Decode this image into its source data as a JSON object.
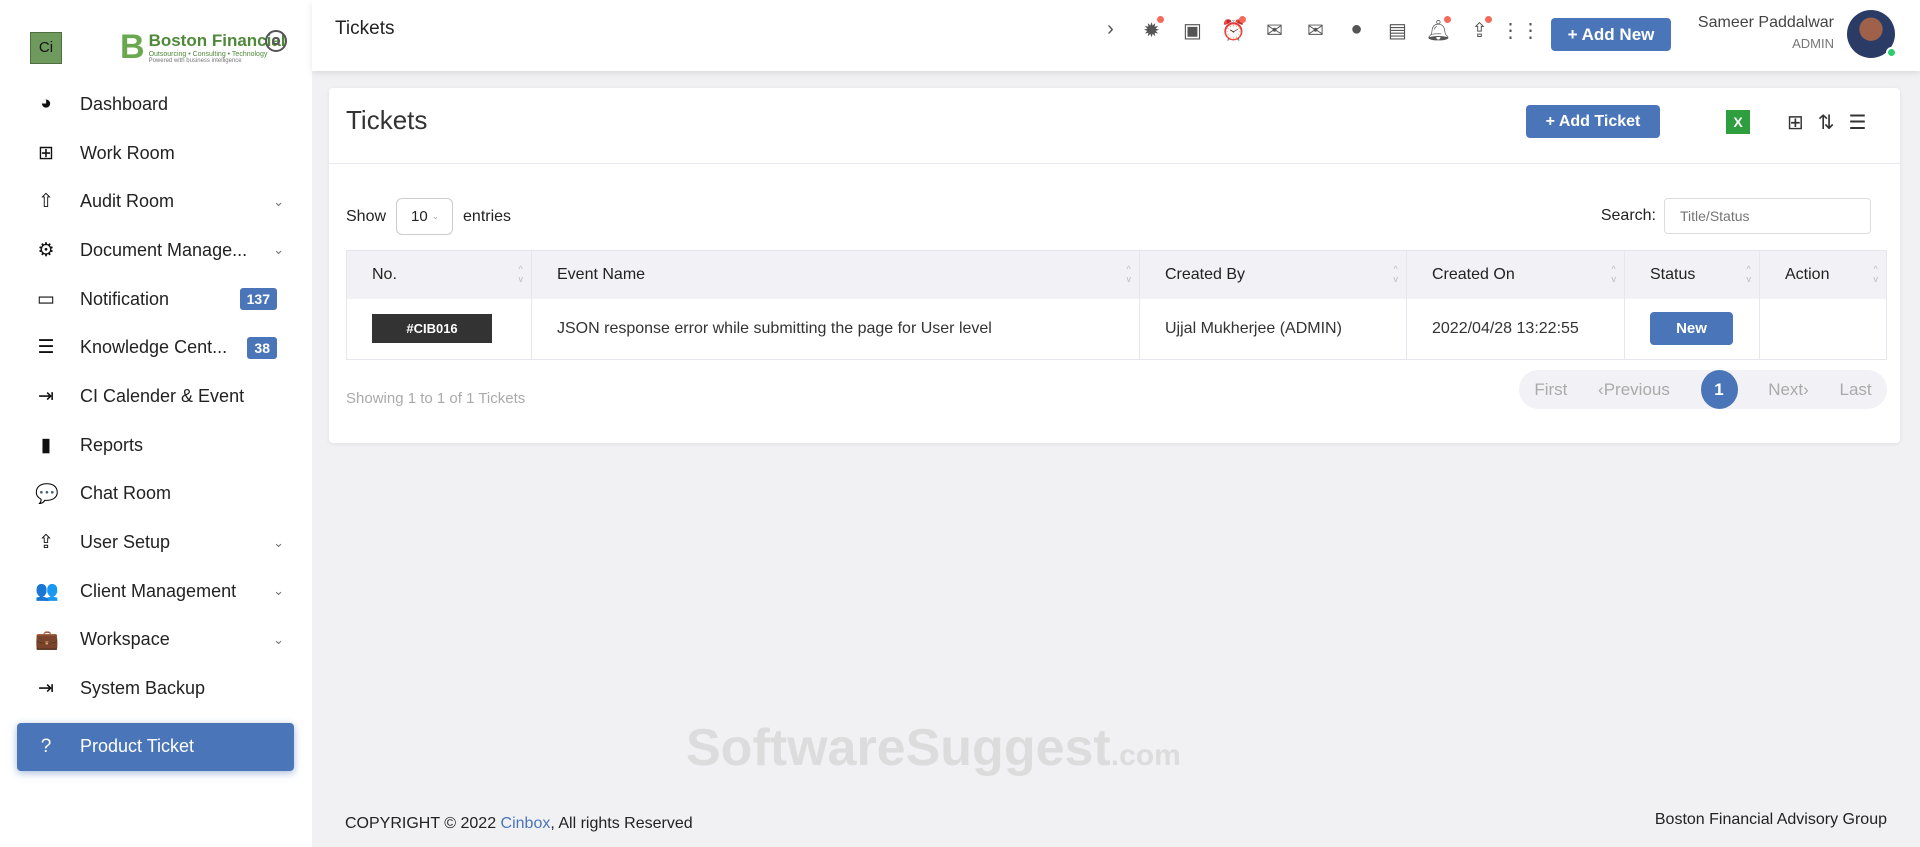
{
  "brand": {
    "ci": "Ci",
    "name": "Boston Financial",
    "tagline": "Outsourcing • Consulting • Technology",
    "sub": "Powered with business intelligence"
  },
  "sidebar": {
    "items": [
      {
        "label": "Dashboard",
        "icon": "◕"
      },
      {
        "label": "Work Room",
        "icon": "⊞"
      },
      {
        "label": "Audit Room",
        "icon": "⇧",
        "chevron": true
      },
      {
        "label": "Document Manage...",
        "icon": "⚙",
        "chevron": true
      },
      {
        "label": "Notification",
        "icon": "▭",
        "badge": "137"
      },
      {
        "label": "Knowledge Cent...",
        "icon": "☰",
        "badge": "38"
      },
      {
        "label": "CI Calender & Event",
        "icon": "⇥"
      },
      {
        "label": "Reports",
        "icon": "▮"
      },
      {
        "label": "Chat Room",
        "icon": "💬"
      },
      {
        "label": "User Setup",
        "icon": "⇪",
        "chevron": true
      },
      {
        "label": "Client Management",
        "icon": "👥",
        "chevron": true
      },
      {
        "label": "Workspace",
        "icon": "💼",
        "chevron": true
      },
      {
        "label": "System Backup",
        "icon": "⇥"
      },
      {
        "label": "Product Ticket",
        "icon": "?"
      }
    ]
  },
  "header": {
    "title": "Tickets",
    "add_new": "+ Add New",
    "user_name": "Sameer Paddalwar",
    "user_role": "ADMIN"
  },
  "card": {
    "title": "Tickets",
    "add_ticket": "+ Add Ticket",
    "excel": "X",
    "show_label": "Show",
    "entries_value": "10",
    "entries_label": "entries",
    "search_label": "Search:",
    "search_placeholder": "Title/Status"
  },
  "table": {
    "headers": [
      "No.",
      "Event Name",
      "Created By",
      "Created On",
      "Status",
      "Action"
    ],
    "rows": [
      {
        "id": "#CIB016",
        "event": "JSON response error while submitting the page for User level",
        "created_by": "Ujjal Mukherjee (ADMIN)",
        "created_on": "2022/04/28 13:22:55",
        "status": "New",
        "action": ""
      }
    ]
  },
  "showing": "Showing 1 to 1 of 1 Tickets",
  "pager": {
    "first": "First",
    "prev": "‹Previous",
    "current": "1",
    "next": "Next›",
    "last": "Last"
  },
  "watermark": {
    "main": "SoftwareSuggest",
    "suffix": ".com"
  },
  "footer": {
    "prefix": "COPYRIGHT © 2022 ",
    "link": "Cinbox",
    "suffix": ", All rights Reserved",
    "right": "Boston Financial Advisory Group"
  },
  "colors": {
    "accent": "#4a76b9"
  }
}
